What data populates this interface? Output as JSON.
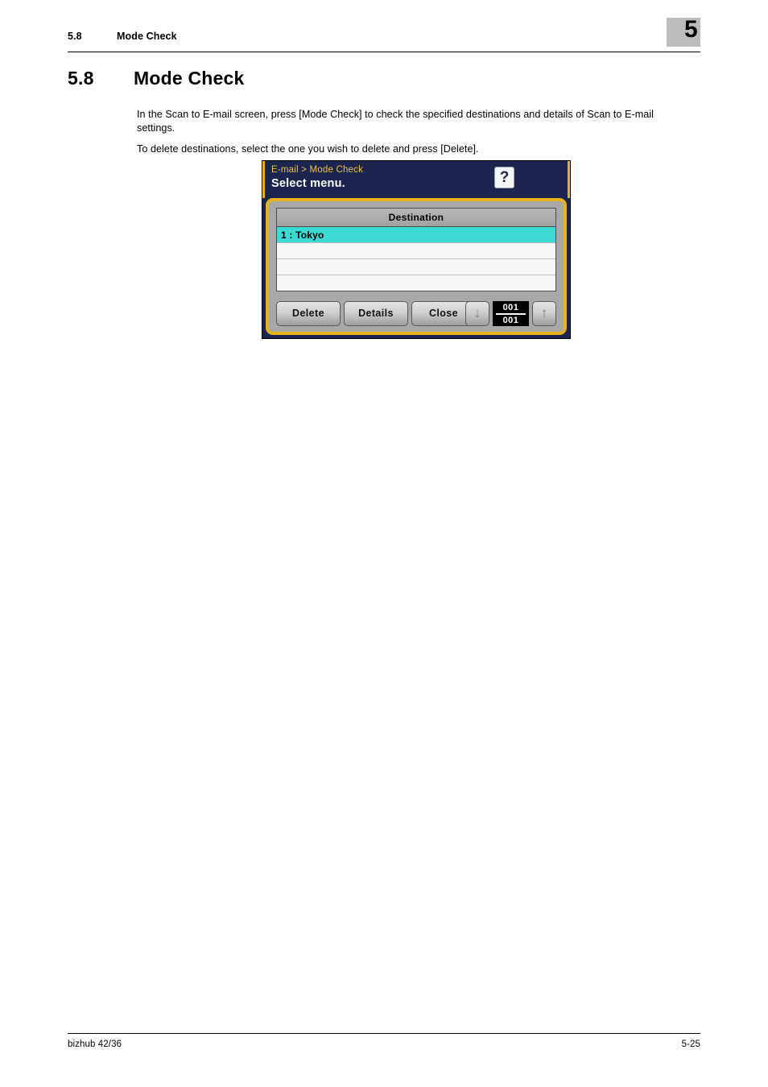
{
  "header": {
    "section_number": "5.8",
    "section_title": "Mode Check",
    "chapter_badge": "5",
    "badge_color": "#bcbcbc"
  },
  "heading": {
    "number": "5.8",
    "title": "Mode Check"
  },
  "body": {
    "paragraph_1": "In the Scan to E-mail screen, press [Mode Check] to check the specified destinations and details of Scan to E-mail settings.",
    "paragraph_2": "To delete destinations, select the one you wish to delete and press [Delete]."
  },
  "device_screen": {
    "breadcrumb": "E-mail > Mode Check",
    "title": "Select menu.",
    "help_icon": "?",
    "colors": {
      "titlebar": "#1b2550",
      "frame_gold": "#e8b21c",
      "body_gray": "#a8a8a8",
      "selected_row": "#3bdbd3",
      "breadcrumb_text": "#f0c23c"
    },
    "list": {
      "column_header": "Destination",
      "rows": [
        {
          "label": "1 : Tokyo",
          "selected": true
        },
        {
          "label": "",
          "selected": false
        },
        {
          "label": "",
          "selected": false
        },
        {
          "label": "",
          "selected": false
        }
      ]
    },
    "buttons": {
      "delete": "Delete",
      "details": "Details",
      "close": "Close"
    },
    "navigation": {
      "down_arrow": "↓",
      "up_arrow": "↑",
      "current_page": "001",
      "total_pages": "001"
    }
  },
  "footer": {
    "model": "bizhub 42/36",
    "page_number": "5-25"
  }
}
